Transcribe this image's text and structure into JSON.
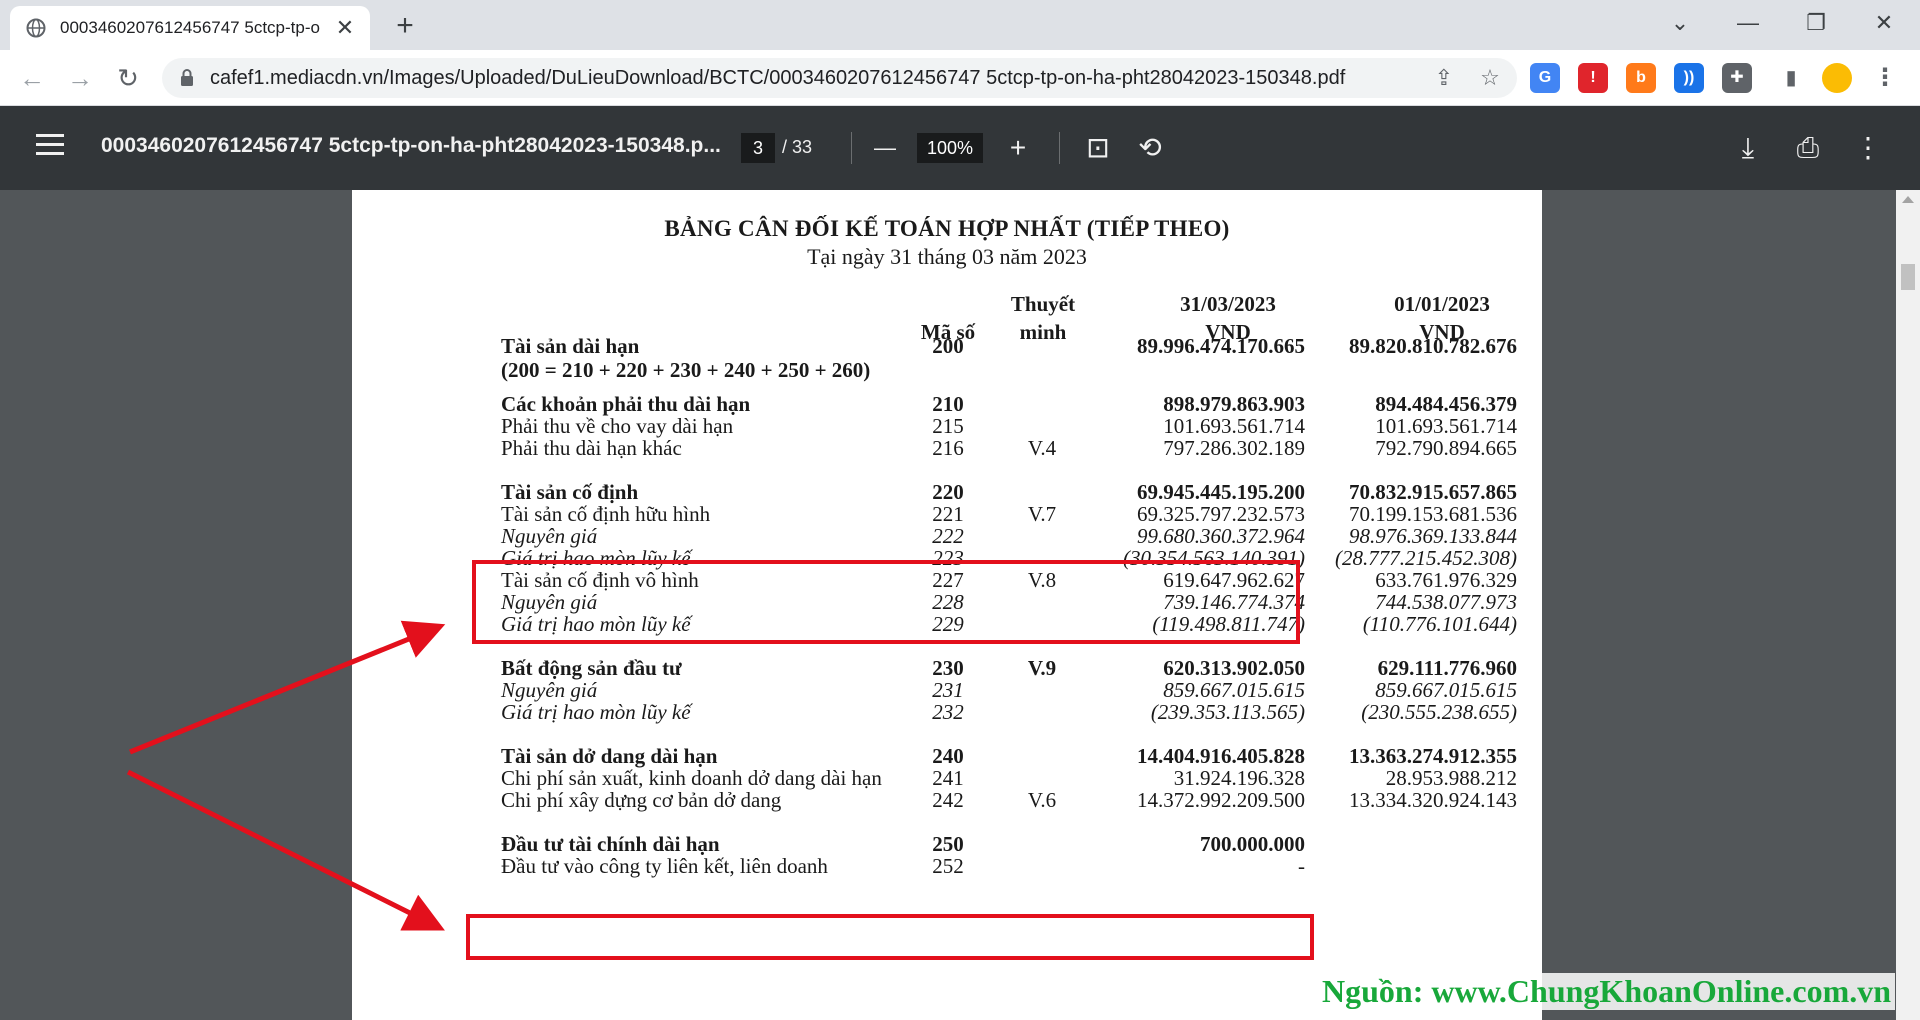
{
  "browser": {
    "tab_title": "0003460207612456747 5ctcp-tp-o",
    "tab_close": "✕",
    "new_tab": "+",
    "url": "cafef1.mediacdn.vn/Images/Uploaded/DuLieuDownload/BCTC/0003460207612456747 5ctcp-tp-on-ha-pht28042023-150348.pdf",
    "win_minimize": "—",
    "win_restore": "❐",
    "win_close": "✕",
    "win_expand": "⌄",
    "back": "←",
    "forward": "→",
    "reload": "↻",
    "share": "⇪",
    "star": "☆",
    "menu": "⋮",
    "extensions": [
      {
        "name": "translate-extension",
        "glyph": "G",
        "color": "#4285f4"
      },
      {
        "name": "adblock-extension",
        "glyph": "!",
        "color": "#e0252c"
      },
      {
        "name": "b-extension",
        "glyph": "b",
        "color": "#ff7a1a"
      },
      {
        "name": "audio-extension",
        "glyph": "))",
        "color": "#1a73e8"
      },
      {
        "name": "puzzle-extension",
        "glyph": "✚",
        "color": "#5f6368"
      }
    ]
  },
  "pdf_viewer": {
    "file_name": "0003460207612456747 5ctcp-tp-on-ha-pht28042023-150348.p...",
    "current_page": "3",
    "total_pages": "/ 33",
    "zoom_out": "—",
    "zoom": "100%",
    "zoom_in": "+",
    "fit_icon": "⊡",
    "rotate_icon": "⟲",
    "download_icon": "⤓",
    "print_icon": "⎙",
    "more_icon": "⋮"
  },
  "document": {
    "title": "BẢNG CÂN ĐỐI KẾ TOÁN HỢP NHẤT (TIẾP THEO)",
    "subtitle": "Tại ngày 31 tháng 03 năm 2023",
    "headers": {
      "code": "Mã số",
      "note_line1": "Thuyết",
      "note_line2": "minh",
      "col1_line1": "31/03/2023",
      "col1_line2": "VND",
      "col2_line1": "01/01/2023",
      "col2_line2": "VND"
    },
    "rows": [
      {
        "label": "Tài sản dài hạn",
        "label2": "(200 = 210 + 220 + 230 + 240 + 250 + 260)",
        "code": "200",
        "note": "",
        "v1": "89.996.474.170.665",
        "v2": "89.820.810.782.676",
        "style": "bold"
      },
      {
        "label": "Các khoản phải thu dài hạn",
        "code": "210",
        "note": "",
        "v1": "898.979.863.903",
        "v2": "894.484.456.379",
        "style": "bold"
      },
      {
        "label": "Phải thu về cho vay dài hạn",
        "code": "215",
        "note": "",
        "v1": "101.693.561.714",
        "v2": "101.693.561.714",
        "style": ""
      },
      {
        "label": "Phải thu dài hạn khác",
        "code": "216",
        "note": "V.4",
        "v1": "797.286.302.189",
        "v2": "792.790.894.665",
        "style": ""
      },
      {
        "label": "Tài sản cố định",
        "code": "220",
        "note": "",
        "v1": "69.945.445.195.200",
        "v2": "70.832.915.657.865",
        "style": "bold"
      },
      {
        "label": "Tài sản cố định hữu hình",
        "code": "221",
        "note": "V.7",
        "v1": "69.325.797.232.573",
        "v2": "70.199.153.681.536",
        "style": ""
      },
      {
        "label": "Nguyên giá",
        "code": "222",
        "note": "",
        "v1": "99.680.360.372.964",
        "v2": "98.976.369.133.844",
        "style": "italic"
      },
      {
        "label": "Giá trị hao mòn lũy kế",
        "code": "223",
        "note": "",
        "v1": "(30.354.563.140.391)",
        "v2": "(28.777.215.452.308)",
        "style": "italic"
      },
      {
        "label": "Tài sản cố định vô hình",
        "code": "227",
        "note": "V.8",
        "v1": "619.647.962.627",
        "v2": "633.761.976.329",
        "style": ""
      },
      {
        "label": "Nguyên giá",
        "code": "228",
        "note": "",
        "v1": "739.146.774.374",
        "v2": "744.538.077.973",
        "style": "italic"
      },
      {
        "label": "Giá trị hao mòn lũy kế",
        "code": "229",
        "note": "",
        "v1": "(119.498.811.747)",
        "v2": "(110.776.101.644)",
        "style": "italic"
      },
      {
        "label": "Bất động sản đầu tư",
        "code": "230",
        "note": "V.9",
        "v1": "620.313.902.050",
        "v2": "629.111.776.960",
        "style": "bold"
      },
      {
        "label": "Nguyên giá",
        "code": "231",
        "note": "",
        "v1": "859.667.015.615",
        "v2": "859.667.015.615",
        "style": "italic"
      },
      {
        "label": "Giá trị hao mòn lũy kế",
        "code": "232",
        "note": "",
        "v1": "(239.353.113.565)",
        "v2": "(230.555.238.655)",
        "style": "italic"
      },
      {
        "label": "Tài sản dở dang dài hạn",
        "code": "240",
        "note": "",
        "v1": "14.404.916.405.828",
        "v2": "13.363.274.912.355",
        "style": "bold"
      },
      {
        "label": "Chi phí sản xuất, kinh doanh dở dang dài hạn",
        "code": "241",
        "note": "",
        "v1": "31.924.196.328",
        "v2": "28.953.988.212",
        "style": ""
      },
      {
        "label": "Chi phí xây dựng cơ bản dở dang",
        "code": "242",
        "note": "V.6",
        "v1": "14.372.992.209.500",
        "v2": "13.334.320.924.143",
        "style": ""
      },
      {
        "label": "Đầu tư tài chính dài hạn",
        "code": "250",
        "note": "",
        "v1": "700.000.000",
        "v2": "",
        "style": "bold"
      },
      {
        "label": "Đầu tư vào công ty liên kết, liên doanh",
        "code": "252",
        "note": "",
        "v1": "-",
        "v2": "",
        "style": ""
      }
    ]
  },
  "annotation": {
    "source": "Nguồn: www.ChungKhoanOnline.com.vn",
    "highlight_color": "#e3101c"
  }
}
